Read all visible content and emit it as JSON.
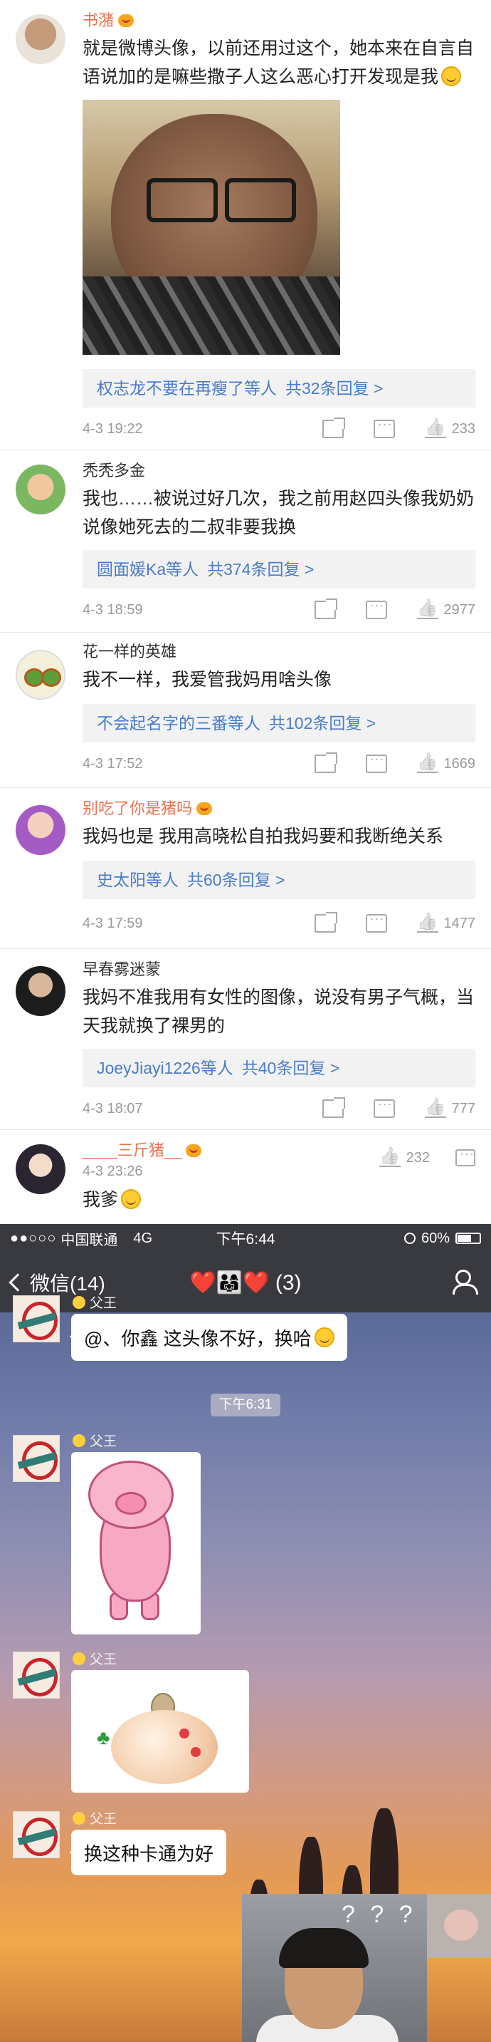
{
  "comments": [
    {
      "user": "书潴",
      "text": "就是微博头像，以前还用过这个，她本来在自言自语说加的是嘛些撒子人这么恶心打开发现是我",
      "reply_users": "权志龙不要在再瘦了等人",
      "reply_count": "共32条回复 >",
      "time": "4-3 19:22",
      "likes": "233"
    },
    {
      "user": "秃秃多金",
      "text": "我也……被说过好几次，我之前用赵四头像我奶奶说像她死去的二叔非要我换",
      "reply_users": "圆面媛Ka等人",
      "reply_count": "共374条回复 >",
      "time": "4-3 18:59",
      "likes": "2977"
    },
    {
      "user": "花一样的英雄",
      "text": "我不一样，我爱管我妈用啥头像",
      "reply_users": "不会起名字的三番等人",
      "reply_count": "共102条回复 >",
      "time": "4-3 17:52",
      "likes": "1669"
    },
    {
      "user": "别吃了你是猪吗",
      "text": "我妈也是 我用高晓松自拍我妈要和我断绝关系",
      "reply_users": "史太阳等人",
      "reply_count": "共60条回复 >",
      "time": "4-3 17:59",
      "likes": "1477"
    },
    {
      "user": "早春雾迷蒙",
      "text": "我妈不准我用有女性的图像，说没有男子气概，当天我就换了裸男的",
      "reply_users": "JoeyJiayi1226等人",
      "reply_count": "共40条回复 >",
      "time": "4-3 18:07",
      "likes": "777"
    },
    {
      "user": "____三斤猪__",
      "text": "我爹",
      "time": "4-3 23:26",
      "likes": "232"
    }
  ],
  "wechat": {
    "status": {
      "signal": "●●○○○",
      "carrier": "中国联通",
      "network": "4G",
      "clock": "下午6:44",
      "battery": "60%"
    },
    "nav": {
      "back_label": "微信(14)",
      "hearts": "❤️👨‍👩‍👧❤️",
      "count": "(3)"
    },
    "sender_name": "父王",
    "timestamp": "下午6:31",
    "messages": [
      {
        "type": "text",
        "text": "@、你鑫 这头像不好，换哈"
      },
      {
        "type": "image",
        "alt": "pink cartoon pig"
      },
      {
        "type": "image",
        "alt": "piggy bank"
      },
      {
        "type": "text",
        "text": "换这种卡通为好"
      }
    ],
    "meme_text": "? ? ?"
  },
  "colors": {
    "weibo_name": "#eb7350",
    "weibo_link": "#4a7cc7",
    "wechat_bar": "#393a3f"
  }
}
